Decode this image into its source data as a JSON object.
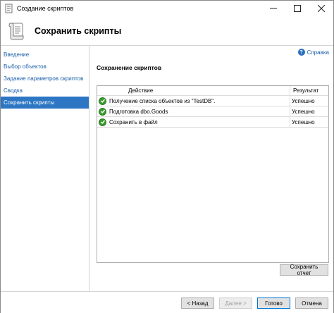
{
  "window": {
    "title": "Создание скриптов"
  },
  "header": {
    "title": "Сохранить скрипты"
  },
  "nav": {
    "items": [
      {
        "label": "Введение",
        "active": false
      },
      {
        "label": "Выбор объектов",
        "active": false
      },
      {
        "label": "Задание параметров скриптов",
        "active": false
      },
      {
        "label": "Сводка",
        "active": false
      },
      {
        "label": "Сохранить скрипты",
        "active": true
      }
    ]
  },
  "main": {
    "help_label": "Справка",
    "section_title": "Сохранение скриптов",
    "grid": {
      "columns": [
        "Действие",
        "Результат"
      ],
      "rows": [
        {
          "action": "Получение списка объектов из \"TestDB\".",
          "result": "Успешно",
          "status_icon": "success-check-icon"
        },
        {
          "action": "Подготовка dbo.Goods",
          "result": "Успешно",
          "status_icon": "success-check-icon"
        },
        {
          "action": "Сохранить в файл",
          "result": "Успешно",
          "status_icon": "success-check-icon"
        }
      ]
    },
    "save_report_label": "Сохранить отчет"
  },
  "footer": {
    "back_label": "< Назад",
    "next_label": "Далее >",
    "done_label": "Готово",
    "cancel_label": "Отмена"
  },
  "colors": {
    "accent": "#2c76c4",
    "link": "#1b5fa8",
    "success": "#3a9a2f"
  }
}
